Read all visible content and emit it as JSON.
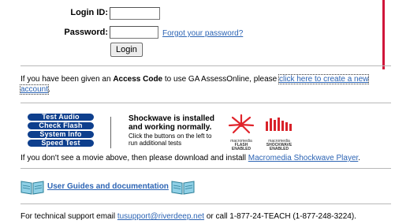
{
  "login": {
    "login_id_label": "Login ID:",
    "login_id_value": "",
    "password_label": "Password:",
    "password_value": "",
    "forgot_link": "Forgot your password?",
    "login_button": "Login"
  },
  "access": {
    "prefix": "If you have been given an ",
    "bold": "Access Code",
    "middle": " to use GA AssessOnline, please ",
    "link_part1": "click here to create a new",
    "link_part2": "account",
    "suffix": "."
  },
  "shockwave": {
    "buttons": [
      "Test Audio",
      "Check Flash",
      "System Info",
      "Speed Test"
    ],
    "status_title_line1": "Shockwave is installed",
    "status_title_line2": "and working normally.",
    "status_note_line1": "Click the buttons on the left to",
    "status_note_line2": "run additional tests",
    "flash_logo_line1": "macromedia",
    "flash_logo_line2": "FLASH",
    "flash_logo_line3": "ENABLED",
    "sw_logo_line1": "macromedia",
    "sw_logo_line2": "SHOCKWAVE",
    "sw_logo_line3": "ENABLED",
    "install_prefix": "If you don't see a movie above, then please download and install ",
    "install_link": "Macromedia Shockwave Player",
    "install_suffix": "."
  },
  "guides": {
    "link": "User Guides and documentation"
  },
  "support": {
    "prefix": "For technical support email ",
    "email": "tusupport@riverdeep.net",
    "suffix": " or call 1-877-24-TEACH (1-877-248-3224)."
  },
  "colors": {
    "accent_red": "#d0163a",
    "button_blue": "#0e3f8d",
    "link": "#2c64b4"
  }
}
